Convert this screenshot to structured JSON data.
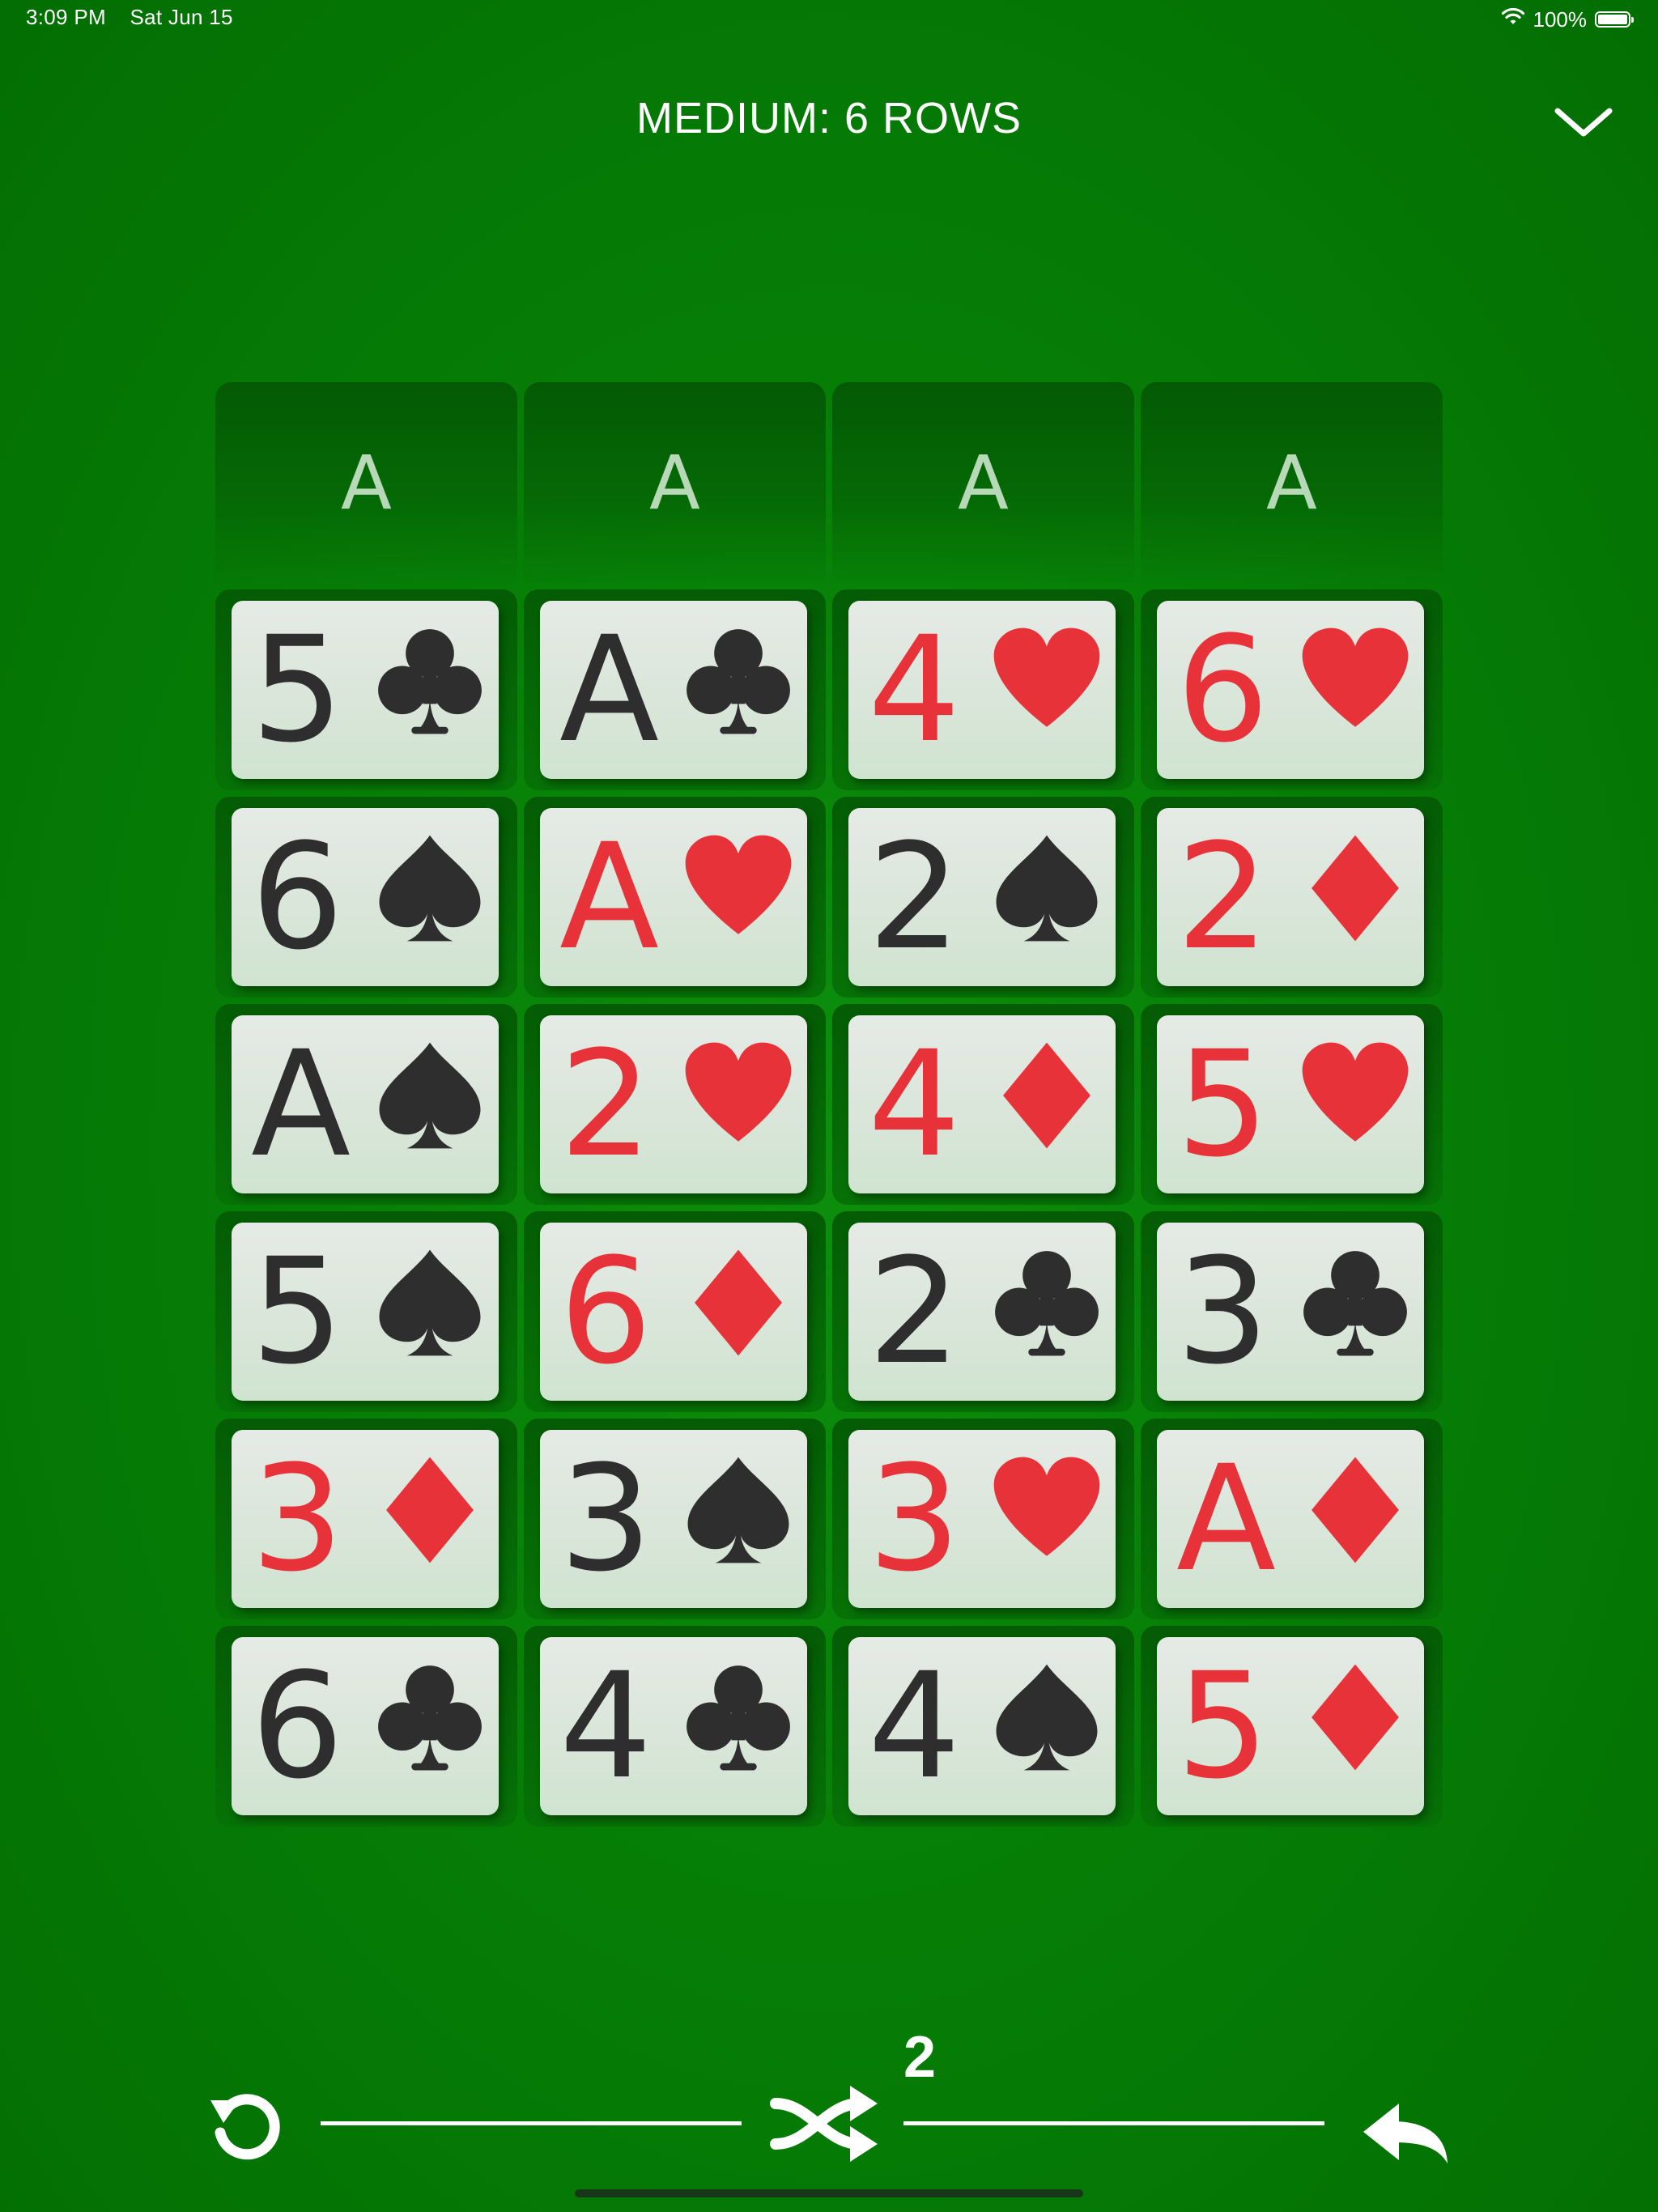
{
  "status_bar": {
    "time": "3:09 PM",
    "date": "Sat Jun 15",
    "battery": "100%",
    "battery_level": 1.0
  },
  "header": {
    "title": "MEDIUM: 6 ROWS"
  },
  "foundations": [
    "A",
    "A",
    "A",
    "A"
  ],
  "board": [
    [
      {
        "rank": "5",
        "suit": "clubs"
      },
      {
        "rank": "A",
        "suit": "clubs"
      },
      {
        "rank": "4",
        "suit": "hearts"
      },
      {
        "rank": "6",
        "suit": "hearts"
      }
    ],
    [
      {
        "rank": "6",
        "suit": "spades"
      },
      {
        "rank": "A",
        "suit": "hearts"
      },
      {
        "rank": "2",
        "suit": "spades"
      },
      {
        "rank": "2",
        "suit": "diamonds"
      }
    ],
    [
      {
        "rank": "A",
        "suit": "spades"
      },
      {
        "rank": "2",
        "suit": "hearts"
      },
      {
        "rank": "4",
        "suit": "diamonds"
      },
      {
        "rank": "5",
        "suit": "hearts"
      }
    ],
    [
      {
        "rank": "5",
        "suit": "spades"
      },
      {
        "rank": "6",
        "suit": "diamonds"
      },
      {
        "rank": "2",
        "suit": "clubs"
      },
      {
        "rank": "3",
        "suit": "clubs"
      }
    ],
    [
      {
        "rank": "3",
        "suit": "diamonds"
      },
      {
        "rank": "3",
        "suit": "spades"
      },
      {
        "rank": "3",
        "suit": "hearts"
      },
      {
        "rank": "A",
        "suit": "diamonds"
      }
    ],
    [
      {
        "rank": "6",
        "suit": "clubs"
      },
      {
        "rank": "4",
        "suit": "clubs"
      },
      {
        "rank": "4",
        "suit": "spades"
      },
      {
        "rank": "5",
        "suit": "diamonds"
      }
    ]
  ],
  "toolbar": {
    "shuffle_count": "2",
    "reload_icon": "reload-icon",
    "shuffle_icon": "shuffle-icon",
    "undo_icon": "undo-icon"
  },
  "colors": {
    "red_suit": "#e8323a",
    "black_suit": "#2e2e2e",
    "felt": "#067f06"
  }
}
